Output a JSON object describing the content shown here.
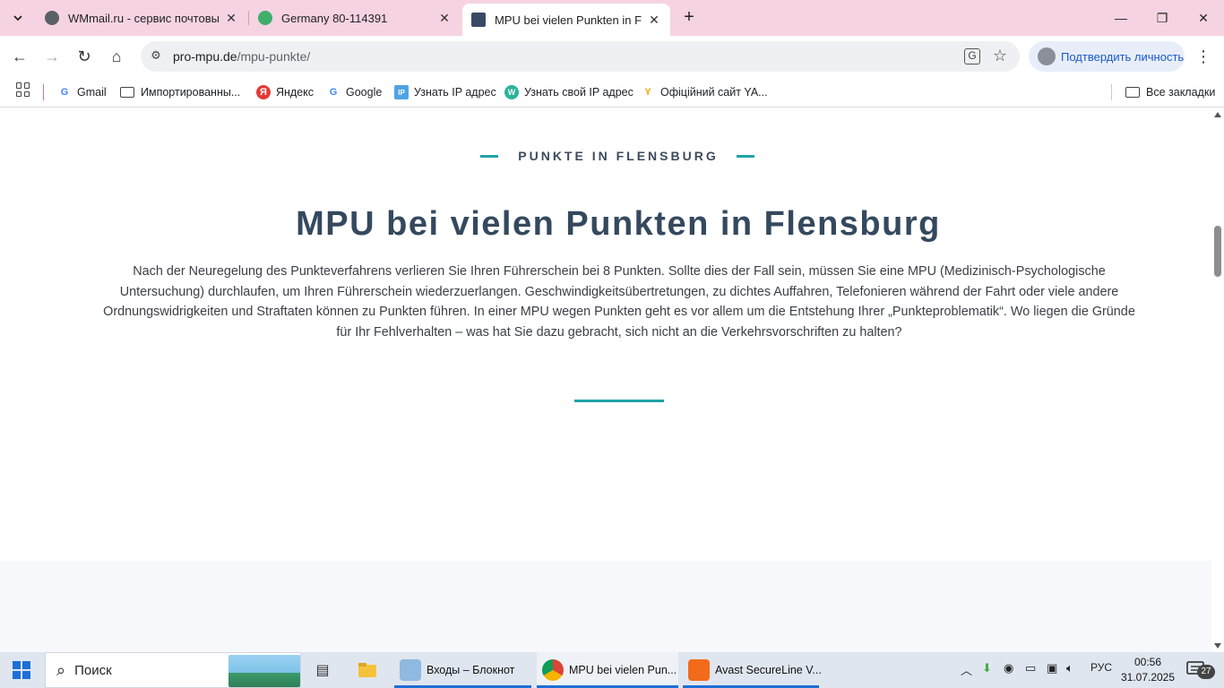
{
  "browser": {
    "tabs": [
      {
        "title": "WMmail.ru - сервис почтовых",
        "favicon": "wmmail-favicon"
      },
      {
        "title": "Germany 80-114391",
        "favicon": "question-favicon"
      },
      {
        "title": "MPU bei vielen Punkten in Flens",
        "favicon": "ma-favicon"
      }
    ],
    "new_tab_label": "+",
    "url_host": "pro-mpu.de",
    "url_path": "/mpu-punkte/",
    "profile_label": "Подтвердить личность",
    "bookmarks": [
      {
        "label": "Gmail"
      },
      {
        "label": "Импортированны..."
      },
      {
        "label": "Яндекс"
      },
      {
        "label": "Google"
      },
      {
        "label": "Узнать IP адрес"
      },
      {
        "label": "Узнать свой IP адрес"
      },
      {
        "label": "Офіційний сайт YA..."
      }
    ],
    "all_bookmarks_label": "Все закладки"
  },
  "page": {
    "eyebrow": "PUNKTE IN FLENSBURG",
    "headline": "MPU bei vielen Punkten in Flensburg",
    "body": "Nach der Neuregelung des Punkteverfahrens verlieren Sie Ihren Führerschein bei 8 Punkten. Sollte dies der Fall sein, müssen Sie eine MPU (Medizinisch-Psychologische Untersuchung) durchlaufen, um Ihren Führerschein wiederzuerlangen. Geschwindigkeitsübertretungen, zu dichtes Auffahren, Telefonieren während der Fahrt oder viele andere Ordnungswidrigkeiten und Straftaten können zu Punkten führen. In einer MPU wegen Punkten geht es vor allem um die Entstehung Ihrer „Punkteproblematik“. Wo liegen die Gründe für Ihr Fehlverhalten – was hat Sie dazu gebracht, sich nicht an die Verkehrsvorschriften zu halten?",
    "accent_color": "#1fa3a8",
    "heading_color": "#34495e"
  },
  "taskbar": {
    "search_label": "Поиск",
    "apps": [
      {
        "label": "Входы – Блокнот"
      },
      {
        "label": "MPU bei vielen Pun..."
      },
      {
        "label": "Avast SecureLine V..."
      }
    ],
    "language": "РУС",
    "time": "00:56",
    "date": "31.07.2025",
    "notification_count": "27"
  }
}
